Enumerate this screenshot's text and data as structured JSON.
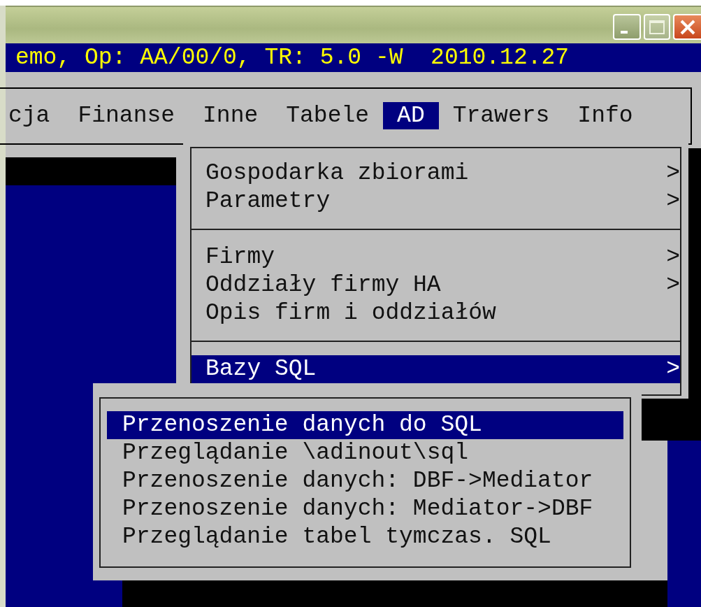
{
  "status_line": {
    "text": "emo, Op: AA/00/0, TR: 5.0 -W  2010.12.27"
  },
  "menu_bar": [
    {
      "label": "cja",
      "selected": false
    },
    {
      "label": "Finanse",
      "selected": false
    },
    {
      "label": "Inne",
      "selected": false
    },
    {
      "label": "Tabele",
      "selected": false
    },
    {
      "label": "AD",
      "selected": true
    },
    {
      "label": "Trawers",
      "selected": false
    },
    {
      "label": "Info",
      "selected": false
    }
  ],
  "dropdown": {
    "items": [
      {
        "kind": "item",
        "label": "Gospodarka zbiorami",
        "arrow": ">",
        "selected": false
      },
      {
        "kind": "item",
        "label": "Parametry",
        "arrow": ">",
        "selected": false
      },
      {
        "kind": "separator"
      },
      {
        "kind": "item",
        "label": "Firmy",
        "arrow": ">",
        "selected": false
      },
      {
        "kind": "item",
        "label": "Oddziały firmy HA",
        "arrow": ">",
        "selected": false
      },
      {
        "kind": "item",
        "label": "Opis firm i oddziałów",
        "selected": false
      },
      {
        "kind": "separator"
      },
      {
        "kind": "item",
        "label": "Bazy SQL",
        "arrow": ">",
        "selected": true
      }
    ]
  },
  "submenu": {
    "items": [
      {
        "label": "Przenoszenie danych do SQL",
        "selected": true
      },
      {
        "label": "Przeglądanie \\adinout\\sql",
        "selected": false
      },
      {
        "label": "Przenoszenie danych: DBF->Mediator",
        "selected": false
      },
      {
        "label": "Przenoszenie danych: Mediator->DBF",
        "selected": false
      },
      {
        "label": "Przeglądanie tabel tymczas. SQL",
        "selected": false
      }
    ]
  }
}
